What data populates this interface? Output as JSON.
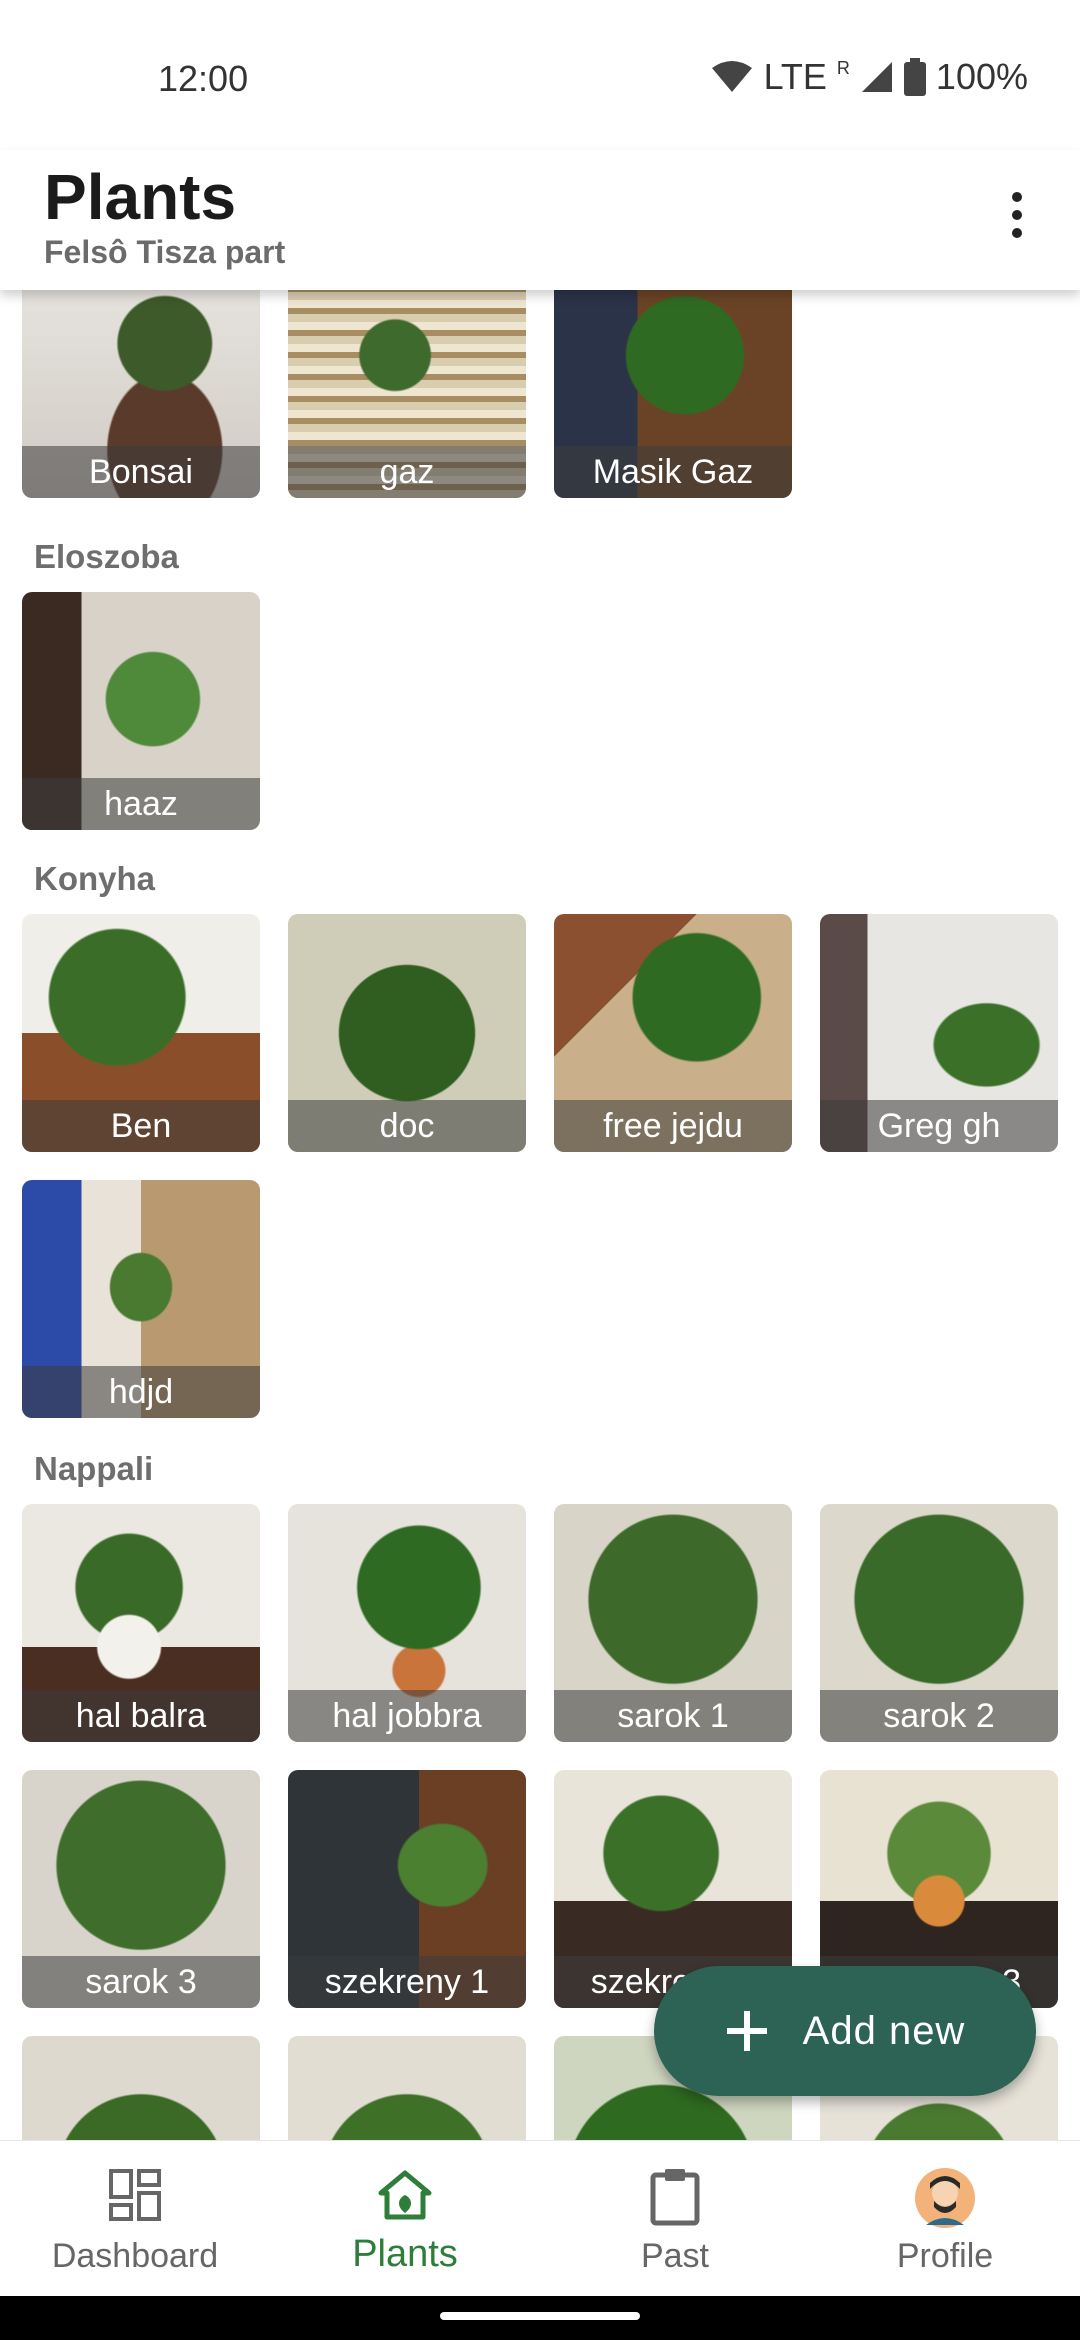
{
  "status_bar": {
    "time": "12:00",
    "network": "LTE",
    "roaming": "R",
    "battery": "100%"
  },
  "app_bar": {
    "title": "Plants",
    "subtitle": "Felsô Tisza part"
  },
  "sections": [
    {
      "label": "",
      "plants": [
        "Bonsai",
        "gaz",
        "Masik Gaz"
      ]
    },
    {
      "label": "Eloszoba",
      "plants": [
        "haaz"
      ]
    },
    {
      "label": "Konyha",
      "plants": [
        "Ben",
        "doc",
        "free jejdu",
        "Greg gh",
        "hdjd"
      ]
    },
    {
      "label": "Nappali",
      "plants": [
        "hal balra",
        "hal jobbra",
        "sarok 1",
        "sarok 2",
        "sarok 3",
        "szekreny 1",
        "szekreny 2",
        "szekreny 3",
        "",
        "",
        "",
        ""
      ]
    }
  ],
  "fab": {
    "label": "Add new",
    "icon": "plus-icon"
  },
  "bottom_nav": [
    {
      "label": "Dashboard",
      "icon": "dashboard-icon",
      "active": false
    },
    {
      "label": "Plants",
      "icon": "home-plants-icon",
      "active": true
    },
    {
      "label": "Past",
      "icon": "clipboard-icon",
      "active": false
    },
    {
      "label": "Profile",
      "icon": "avatar-icon",
      "active": false
    }
  ],
  "colors": {
    "accent": "#2c6355",
    "active_nav": "#2e7d3a",
    "section_label": "#6e6e6e"
  }
}
